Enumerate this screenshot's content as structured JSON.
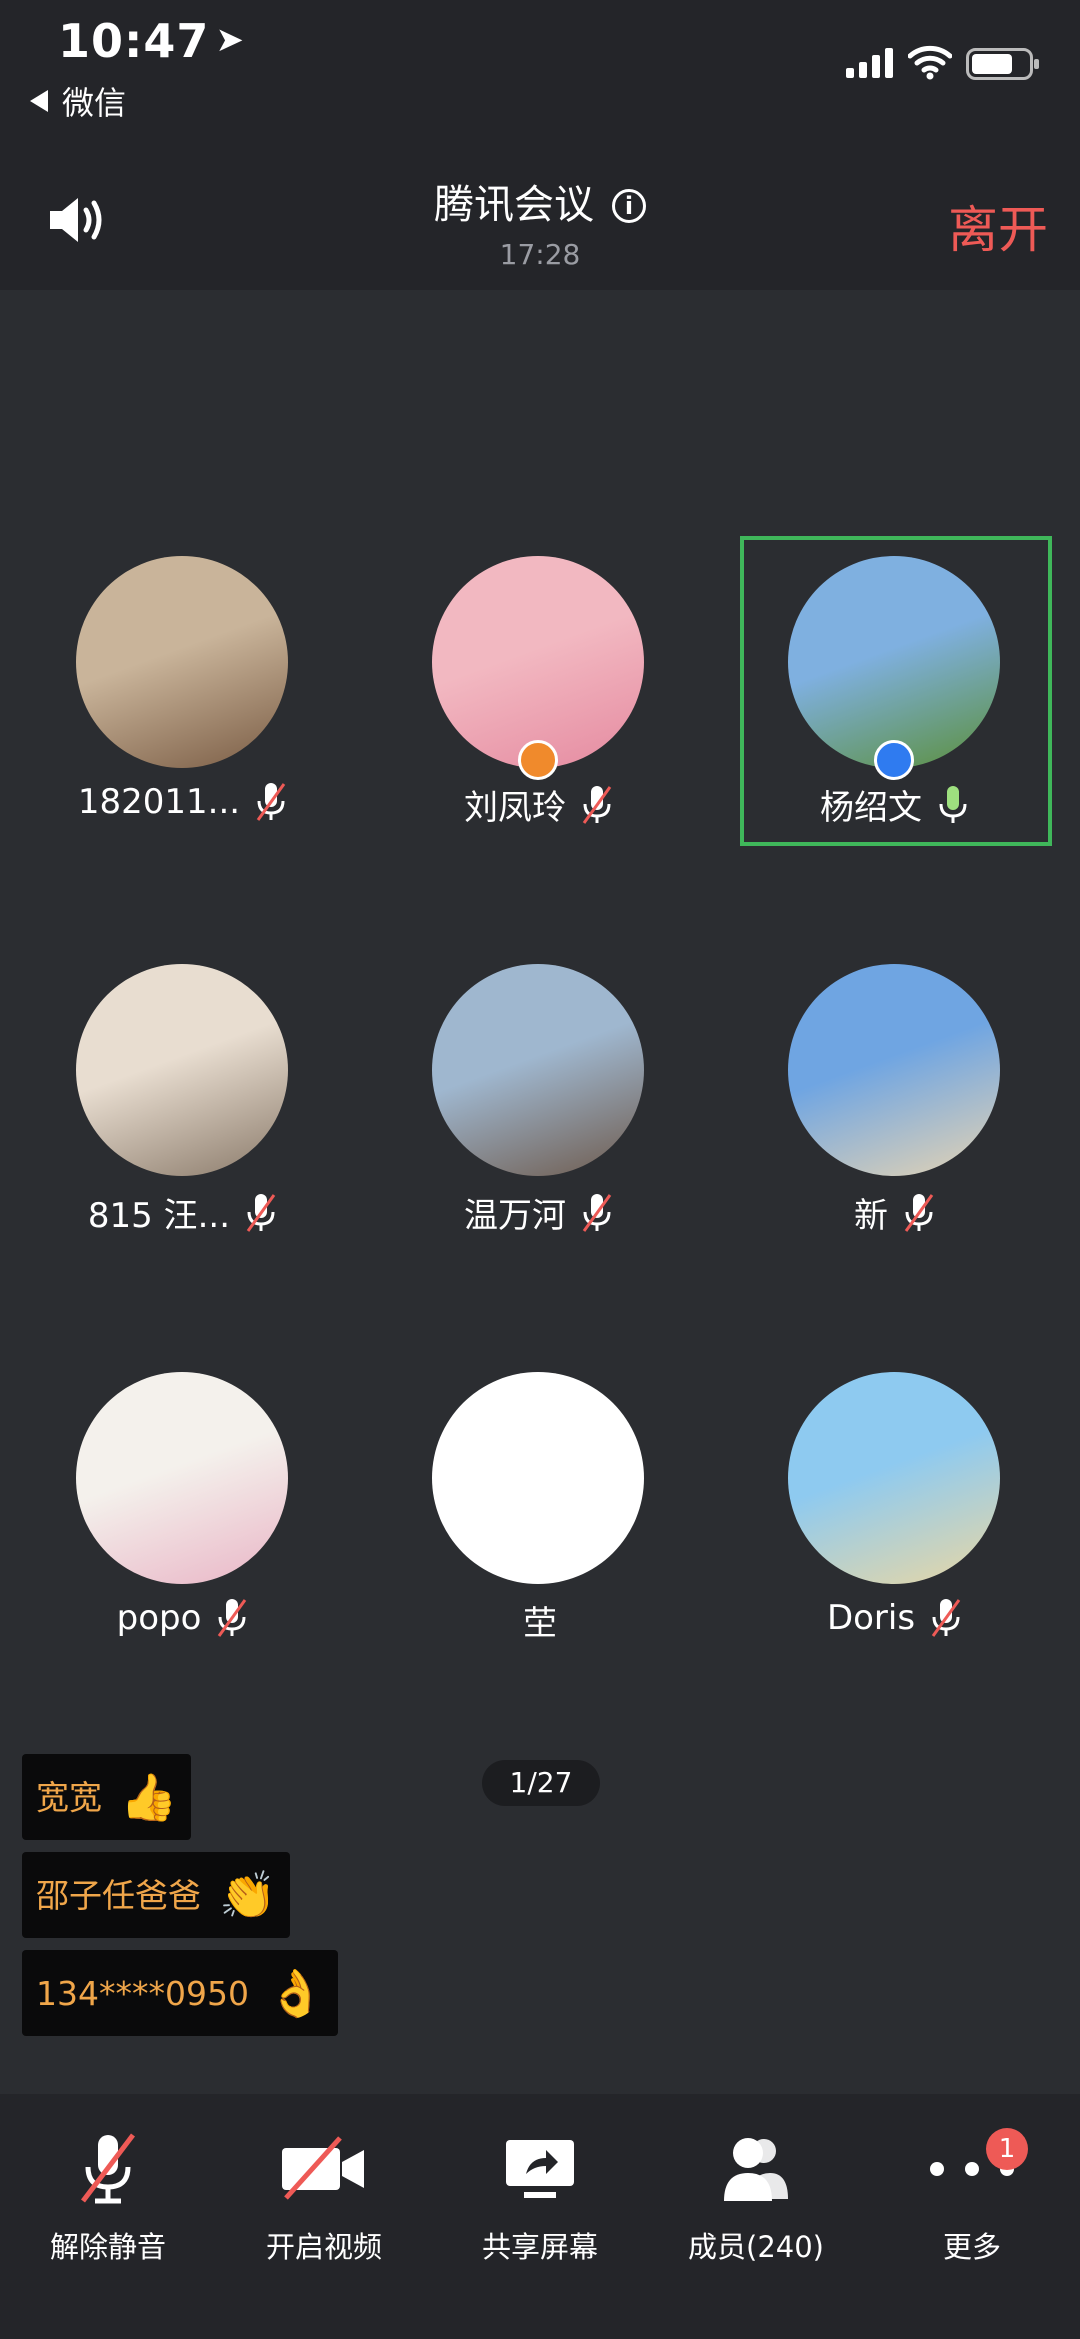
{
  "status_bar": {
    "time": "10:47",
    "back_app": "微信"
  },
  "header": {
    "title": "腾讯会议",
    "duration": "17:28",
    "leave_label": "离开",
    "info_glyph": "i"
  },
  "participants": [
    {
      "name": "182011...",
      "mic": "muted",
      "colors": [
        "#c9b49a",
        "#7a5c44"
      ]
    },
    {
      "name": "刘凤玲",
      "mic": "muted",
      "role": "host",
      "colors": [
        "#f2b8c1",
        "#e58aa0"
      ]
    },
    {
      "name": "杨绍文",
      "mic": "on",
      "role": "cohost",
      "active_speaker": true,
      "colors": [
        "#7fb0e0",
        "#5b8f3a"
      ]
    },
    {
      "name": "815 汪...",
      "mic": "muted",
      "colors": [
        "#e8ddd0",
        "#8a7a6a"
      ]
    },
    {
      "name": "温万河",
      "mic": "muted",
      "colors": [
        "#9fb7cf",
        "#6e5a4c"
      ]
    },
    {
      "name": "新",
      "mic": "muted",
      "colors": [
        "#6fa5e2",
        "#e6d4b3"
      ]
    },
    {
      "name": "popo",
      "mic": "muted",
      "colors": [
        "#f4f1ec",
        "#e9b5c6"
      ]
    },
    {
      "name": "茔",
      "mic": "none",
      "colors": [
        "#ffffff",
        "#ffffff"
      ]
    },
    {
      "name": "Doris",
      "mic": "muted",
      "colors": [
        "#8ecaf0",
        "#e9d7a4"
      ]
    }
  ],
  "pager": "1/27",
  "reactions": [
    {
      "name": "宽宽",
      "emoji": "👍"
    },
    {
      "name": "邵子任爸爸",
      "emoji": "👏"
    },
    {
      "name": "134****0950",
      "emoji": "👌"
    }
  ],
  "toolbar": {
    "unmute": "解除静音",
    "video": "开启视频",
    "share": "共享屏幕",
    "members": "成员(240)",
    "more": "更多",
    "more_badge": "1"
  },
  "colors": {
    "accent_red": "#ee5a56",
    "speaker_green": "#3fb75a",
    "reaction_text": "#f0a64a"
  }
}
